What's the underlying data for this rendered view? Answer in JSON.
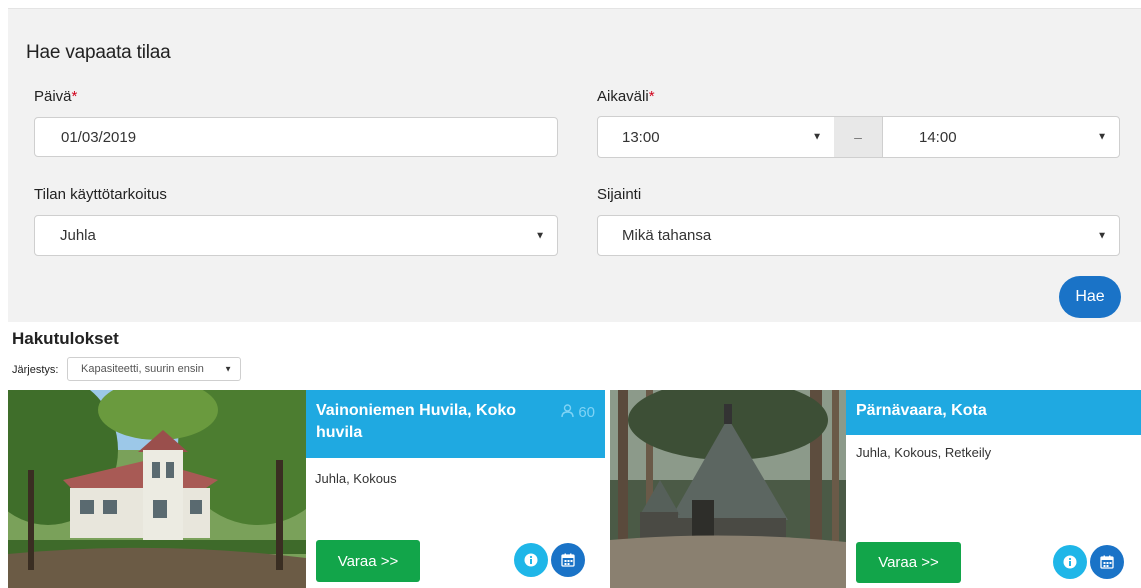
{
  "search": {
    "title": "Hae vapaata tilaa",
    "date": {
      "label": "Päivä",
      "required_mark": "*",
      "value": "01/03/2019"
    },
    "timerange": {
      "label": "Aikaväli",
      "required_mark": "*",
      "from": "13:00",
      "separator": "–",
      "to": "14:00"
    },
    "purpose": {
      "label": "Tilan käyttötarkoitus",
      "value": "Juhla"
    },
    "location": {
      "label": "Sijainti",
      "value": "Mikä tahansa"
    },
    "button": "Hae"
  },
  "results": {
    "title": "Hakutulokset",
    "sort_label": "Järjestys:",
    "sort_value": "Kapasiteetti, suurin ensin",
    "cards": [
      {
        "title": "Vainoniemen Huvila, Koko huvila",
        "capacity": "60",
        "tags": "Juhla, Kokous",
        "book": "Varaa >>"
      },
      {
        "title": "Pärnävaara, Kota",
        "tags": "Juhla, Kokous, Retkeily",
        "book": "Varaa >>"
      }
    ]
  },
  "icons": {
    "select_arrow": "caret-down-icon",
    "capacity": "person-icon",
    "info": "info-icon",
    "calendar": "calendar-icon"
  },
  "colors": {
    "accent_blue": "#1fa9e1",
    "primary_blue": "#1a73c7",
    "book_green": "#12a54a",
    "required_red": "#d0021b",
    "panel_bg": "#f2f2f2"
  }
}
